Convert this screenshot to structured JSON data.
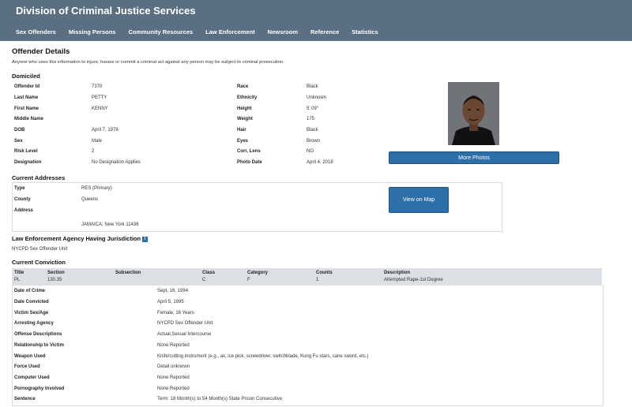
{
  "header": {
    "title": "Division of Criminal Justice Services",
    "nav": [
      "Sex Offenders",
      "Missing Persons",
      "Community Resources",
      "Law Enforcement",
      "Newsroom",
      "Reference",
      "Statistics"
    ]
  },
  "page": {
    "title": "Offender Details",
    "disclaimer": "Anyone who uses this information to injure, harass or commit a criminal act against any person may be subject to criminal prosecution.",
    "status": "Domiciled"
  },
  "details": {
    "left": [
      {
        "label": "Offender Id",
        "value": "7370"
      },
      {
        "label": "Last Name",
        "value": "PETTY"
      },
      {
        "label": "First Name",
        "value": "KENNY"
      },
      {
        "label": "Middle Name",
        "value": ""
      },
      {
        "label": "DOB",
        "value": "April 7, 1978"
      },
      {
        "label": "Sex",
        "value": "Male"
      },
      {
        "label": "Risk Level",
        "value": "2"
      },
      {
        "label": "Designation",
        "value": "No Designation Applies"
      }
    ],
    "right": [
      {
        "label": "Race",
        "value": "Black"
      },
      {
        "label": "Ethnicity",
        "value": "Unknown"
      },
      {
        "label": "Height",
        "value": "5' 09\""
      },
      {
        "label": "Weight",
        "value": "175"
      },
      {
        "label": "Hair",
        "value": "Black"
      },
      {
        "label": "Eyes",
        "value": "Brown"
      },
      {
        "label": "Corr. Lens",
        "value": "NO"
      },
      {
        "label": "Photo Date",
        "value": "April 4, 2018"
      }
    ],
    "more_photos_label": "More Photos"
  },
  "addresses": {
    "title": "Current Addresses",
    "rows": [
      {
        "label": "Type",
        "value": "RES (Primary)"
      },
      {
        "label": "County",
        "value": "Queens"
      },
      {
        "label": "Address",
        "value": ""
      }
    ],
    "address_city": "JAMAICA, New York 11436",
    "view_map_label": "View on Map"
  },
  "agency": {
    "title": "Law Enforcement Agency Having Jurisdiction",
    "value": "NYCPD Sex Offender Unit"
  },
  "conviction": {
    "title": "Current Conviction",
    "columns": [
      "Title",
      "Section",
      "Subsection",
      "Class",
      "Category",
      "Counts",
      "Description"
    ],
    "values": [
      "PL",
      "130.35",
      "",
      "C",
      "F",
      "1",
      "Attempted Rape-1st Degree"
    ],
    "details": [
      {
        "label": "Date of Crime",
        "value": "Sept. 16, 1994"
      },
      {
        "label": "Date Convicted",
        "value": "April 5, 1995"
      },
      {
        "label": "Victim Sex/Age",
        "value": "Female, 16 Years"
      },
      {
        "label": "Arresting Agency",
        "value": "NYCPD Sex Offender Unit"
      },
      {
        "label": "Offense Descriptions",
        "value": "Actual,Sexual Intercourse"
      },
      {
        "label": "Relationship to Victim",
        "value": "None Reported"
      },
      {
        "label": "Weapon Used",
        "value": "Knife/cutting instrument (e.g., ax, ice pick, screwdriver, switchblade, Kung Fu stars, cane sword, etc.)"
      },
      {
        "label": "Force Used",
        "value": "Detail unknown"
      },
      {
        "label": "Computer Used",
        "value": "None Reported"
      },
      {
        "label": "Pornography Involved",
        "value": "None Reported"
      },
      {
        "label": "Sentence",
        "value": "Term: 18 Month(s) to 54 Month(s) State Prison Consecutive"
      }
    ]
  }
}
